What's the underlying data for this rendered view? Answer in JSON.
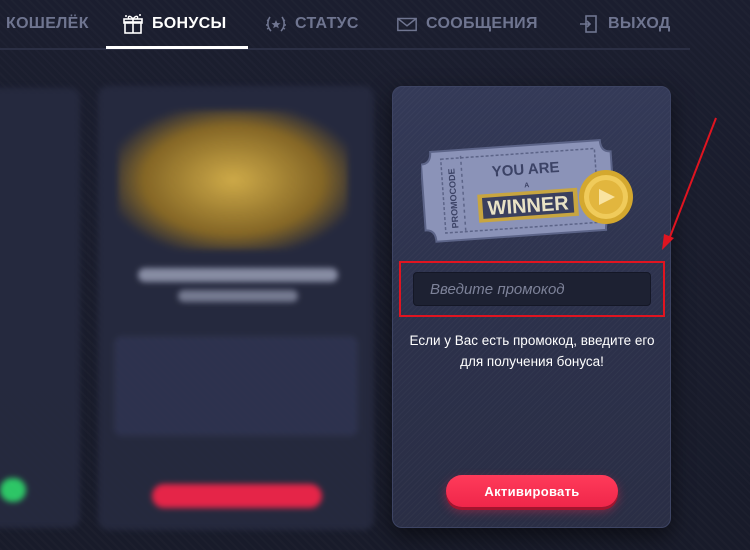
{
  "nav": {
    "items": [
      {
        "label": "Кошелёк",
        "icon": "wallet-icon",
        "active": false
      },
      {
        "label": "Бонусы",
        "icon": "gift-icon",
        "active": true
      },
      {
        "label": "Статус",
        "icon": "laurel-icon",
        "active": false
      },
      {
        "label": "Сообщения",
        "icon": "envelope-icon",
        "active": false
      },
      {
        "label": "Выход",
        "icon": "logout-icon",
        "active": false
      }
    ]
  },
  "promo": {
    "ticket_text_top": "YOU ARE",
    "ticket_text_a": "A",
    "ticket_text_main": "WINNER",
    "ticket_side_text": "PROMOCODE",
    "input_placeholder": "Введите промокод",
    "description": "Если у Вас есть промокод, введите его для получения бонуса!",
    "activate_label": "Активировать"
  },
  "colors": {
    "accent": "#f0264a",
    "annotation": "#e01420",
    "card_bg": "#2c314b",
    "page_bg": "#1a1d2d"
  }
}
